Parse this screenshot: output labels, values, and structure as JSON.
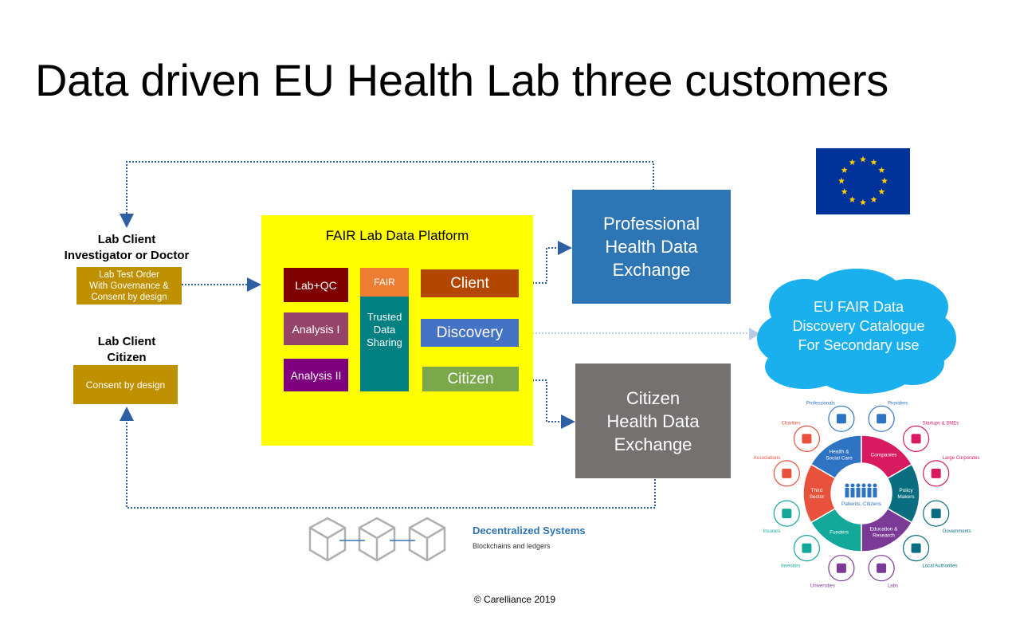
{
  "title": "Data driven EU Health Lab three customers",
  "lab_client_doctor": {
    "heading_line1": "Lab Client",
    "heading_line2": "Investigator or Doctor",
    "box_line1": "Lab Test Order",
    "box_line2": "With Governance &",
    "box_line3": "Consent by design"
  },
  "lab_client_citizen": {
    "heading_line1": "Lab Client",
    "heading_line2": "Citizen",
    "box": "Consent by design"
  },
  "platform": {
    "title": "FAIR Lab Data Platform",
    "lab_qc": "Lab+QC",
    "analysis1": "Analysis I",
    "analysis2": "Analysis II",
    "fair": "FAIR",
    "trusted_line1": "Trusted",
    "trusted_line2": "Data",
    "trusted_line3": "Sharing",
    "client": "Client",
    "discovery": "Discovery",
    "citizen": "Citizen"
  },
  "professional_exchange": {
    "line1": "Professional",
    "line2": "Health Data",
    "line3": "Exchange"
  },
  "citizen_exchange": {
    "line1": "Citizen",
    "line2": "Health Data",
    "line3": "Exchange"
  },
  "cloud": {
    "line1": "EU FAIR Data",
    "line2": "Discovery Catalogue",
    "line3": "For Secondary use"
  },
  "decentralized": {
    "title": "Decentralized Systems",
    "subtitle": "Blockchains and ledgers"
  },
  "copyright": "© Carelliance 2019",
  "wheel": {
    "center": "Patients, Citizens",
    "segments": [
      {
        "label": "Health & Social Care",
        "color": "#2F73C3"
      },
      {
        "label": "Companies",
        "color": "#D81B60"
      },
      {
        "label": "Policy Makers",
        "color": "#0A6E80"
      },
      {
        "label": "Education & Research",
        "color": "#7B3A96"
      },
      {
        "label": "Funders",
        "color": "#13A89A"
      },
      {
        "label": "Third Sector",
        "color": "#E8523C"
      }
    ],
    "stakeholders": [
      {
        "label": "Providers",
        "color": "#2F73C3"
      },
      {
        "label": "Startups & SMEs",
        "color": "#D81B60"
      },
      {
        "label": "Large Corporates",
        "color": "#D81B60"
      },
      {
        "label": "Governments",
        "color": "#0A6E80"
      },
      {
        "label": "Local Authorities",
        "color": "#0A6E80"
      },
      {
        "label": "Labs",
        "color": "#7B3A96"
      },
      {
        "label": "Universities",
        "color": "#7B3A96"
      },
      {
        "label": "Investors",
        "color": "#13A89A"
      },
      {
        "label": "Insurers",
        "color": "#13A89A"
      },
      {
        "label": "Associations",
        "color": "#E8523C"
      },
      {
        "label": "Charities",
        "color": "#E8523C"
      },
      {
        "label": "Professionals",
        "color": "#2F73C3"
      }
    ]
  },
  "colors": {
    "gold": "#BF9000",
    "yellow": "#FFFF00",
    "professional": "#2E75B6",
    "citizen_exchange": "#767171",
    "cloud": "#1AB0EE",
    "eu_flag": "#003399",
    "star": "#FFCC00",
    "connector": "#2E5FA0"
  }
}
